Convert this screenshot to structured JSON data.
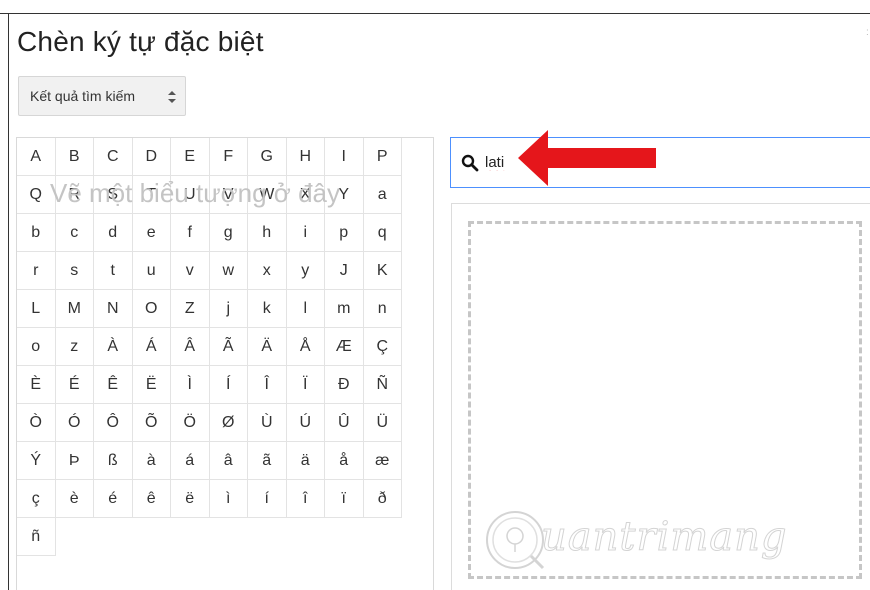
{
  "dialog": {
    "title": "Chèn ký tự đặc biệt"
  },
  "category_select": {
    "label": "Kết quả tìm kiếm"
  },
  "characters": [
    "A",
    "B",
    "C",
    "D",
    "E",
    "F",
    "G",
    "H",
    "I",
    "P",
    "Q",
    "R",
    "S",
    "T",
    "U",
    "V",
    "W",
    "X",
    "Y",
    "a",
    "b",
    "c",
    "d",
    "e",
    "f",
    "g",
    "h",
    "i",
    "p",
    "q",
    "r",
    "s",
    "t",
    "u",
    "v",
    "w",
    "x",
    "y",
    "J",
    "K",
    "L",
    "M",
    "N",
    "O",
    "Z",
    "j",
    "k",
    "l",
    "m",
    "n",
    "o",
    "z",
    "À",
    "Á",
    "Â",
    "Ã",
    "Ä",
    "Å",
    "Æ",
    "Ç",
    "È",
    "É",
    "Ê",
    "Ë",
    "Ì",
    "Í",
    "Î",
    "Ï",
    "Ð",
    "Ñ",
    "Ò",
    "Ó",
    "Ô",
    "Õ",
    "Ö",
    "Ø",
    "Ù",
    "Ú",
    "Û",
    "Ü",
    "Ý",
    "Þ",
    "ß",
    "à",
    "á",
    "â",
    "ã",
    "ä",
    "å",
    "æ",
    "ç",
    "è",
    "é",
    "ê",
    "ë",
    "ì",
    "í",
    "î",
    "ï",
    "ð",
    "ñ"
  ],
  "search": {
    "value": "lati",
    "icon": "search-icon"
  },
  "draw": {
    "placeholder": "Vẽ một biểu tượng ở đây"
  },
  "annotation": {
    "icon": "red-arrow-icon",
    "color": "#e5161b"
  },
  "watermark": {
    "text": "uantrimang"
  }
}
